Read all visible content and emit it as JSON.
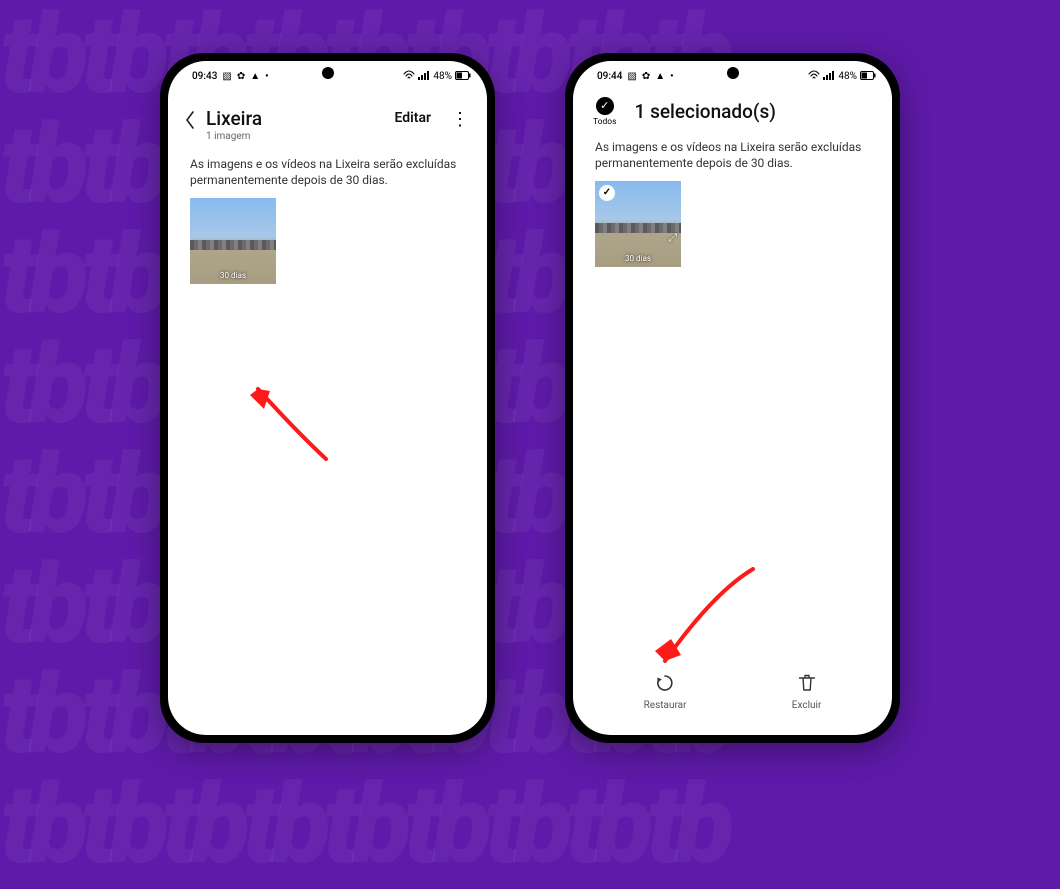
{
  "screens": [
    {
      "status": {
        "time": "09:43",
        "battery": "48%"
      },
      "header": {
        "title": "Lixeira",
        "subtitle": "1 imagem",
        "edit": "Editar"
      },
      "info": "As imagens e os vídeos na Lixeira serão excluídas permanentemente depois de 30 dias.",
      "thumb_badge": "30 dias"
    },
    {
      "status": {
        "time": "09:44",
        "battery": "48%"
      },
      "sel_header": {
        "all_label": "Todos",
        "title": "1 selecionado(s)"
      },
      "info": "As imagens e os vídeos na Lixeira serão excluídas permanentemente depois de 30 dias.",
      "thumb_badge": "30 dias",
      "bottom": {
        "restore": "Restaurar",
        "delete": "Excluir"
      }
    }
  ]
}
